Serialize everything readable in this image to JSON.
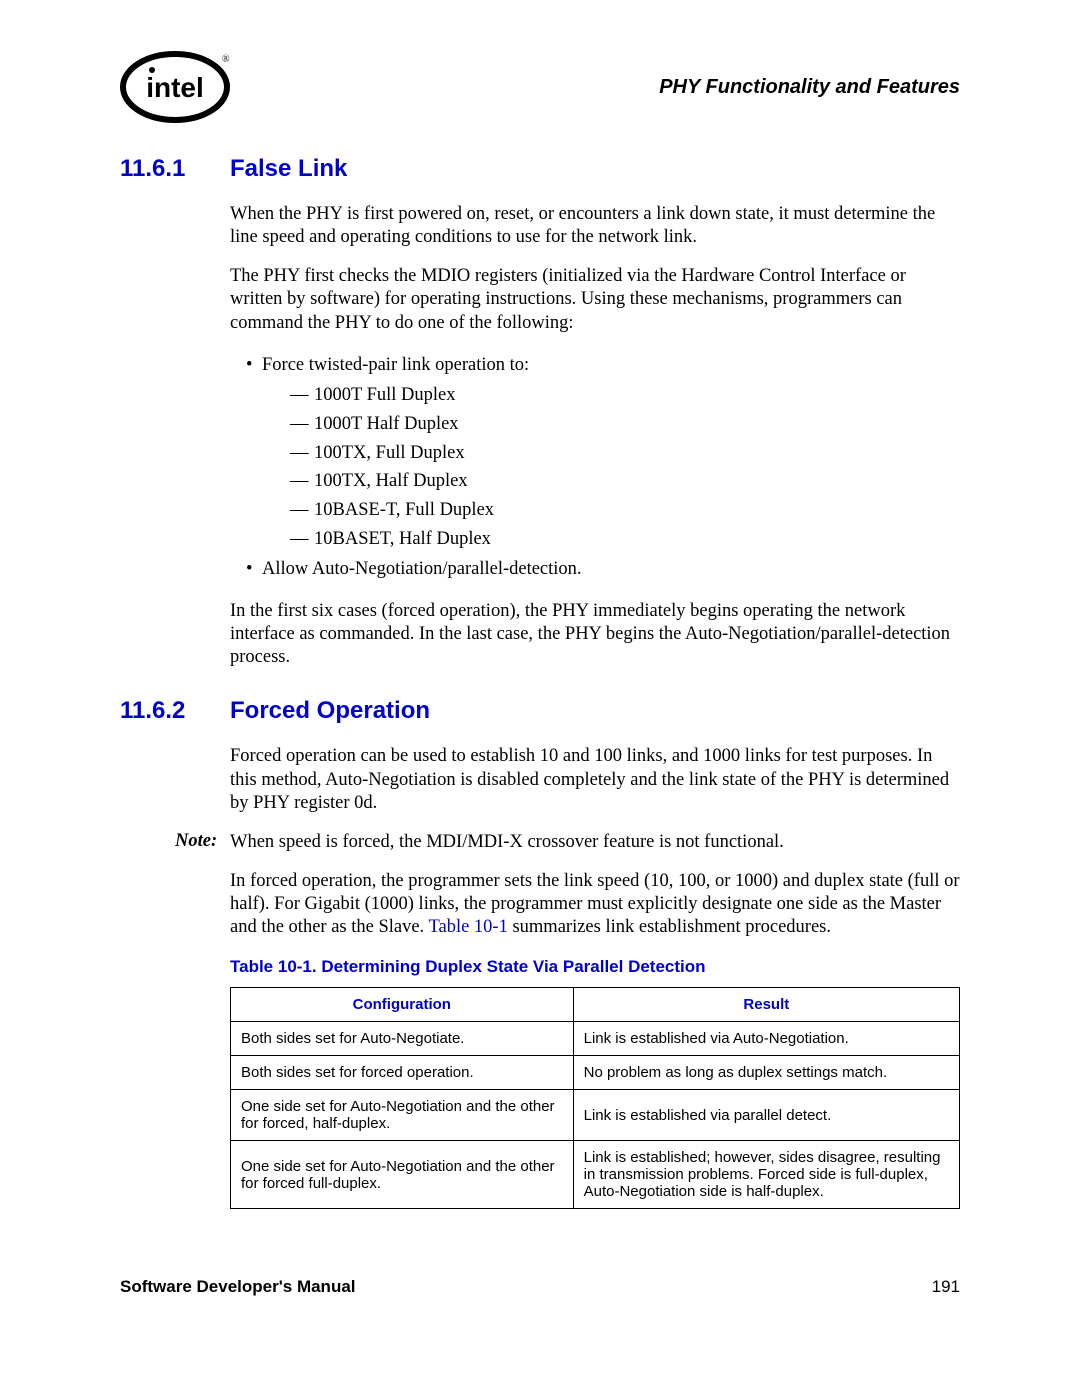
{
  "header": {
    "title": "PHY Functionality and Features"
  },
  "sections": [
    {
      "number": "11.6.1",
      "title": "False Link",
      "paragraphs": [
        "When the PHY is first powered on, reset, or encounters a link down state, it must determine the line speed and operating conditions to use for the network link.",
        "The PHY first checks the MDIO registers (initialized via the Hardware Control Interface or written by software) for operating instructions. Using these mechanisms, programmers can command the PHY to do one of the following:"
      ],
      "bullets": [
        {
          "text": "Force twisted-pair link operation to:",
          "sub": [
            "1000T Full Duplex",
            "1000T Half Duplex",
            "100TX, Full Duplex",
            "100TX, Half Duplex",
            "10BASE-T, Full Duplex",
            "10BASET, Half Duplex"
          ]
        },
        {
          "text": "Allow Auto-Negotiation/parallel-detection."
        }
      ],
      "trailing": "In the first six cases (forced operation), the PHY immediately begins operating the network interface as commanded. In the last case, the PHY begins the Auto-Negotiation/parallel-detection process."
    },
    {
      "number": "11.6.2",
      "title": "Forced Operation",
      "paragraphs": [
        "Forced operation can be used to establish 10 and 100 links, and 1000 links for test purposes. In this method, Auto-Negotiation is disabled completely and the link state of the PHY is determined by PHY register 0d."
      ],
      "note_label": "Note:",
      "note": "When speed is forced, the MDI/MDI-X crossover feature is not functional.",
      "after_note_pre": "In forced operation, the programmer sets the link speed (10, 100, or 1000) and duplex state (full or half). For Gigabit (1000) links, the programmer must explicitly designate one side as the Master and the other as the Slave. ",
      "after_note_link": "Table 10-1",
      "after_note_post": " summarizes link establishment procedures.",
      "table_title": "Table 10-1. Determining Duplex State Via Parallel Detection",
      "table": {
        "headers": [
          "Configuration",
          "Result"
        ],
        "rows": [
          [
            "Both sides set for Auto-Negotiate.",
            "Link is established via Auto-Negotiation."
          ],
          [
            "Both sides set for forced operation.",
            "No problem as long as duplex settings match."
          ],
          [
            "One side set for Auto-Negotiation and the other for forced, half-duplex.",
            "Link is established via parallel detect."
          ],
          [
            "One side set for Auto-Negotiation and the other for forced full-duplex.",
            "Link is established; however, sides disagree, resulting in transmission problems. Forced side is full-duplex, Auto-Negotiation side is half-duplex."
          ]
        ]
      }
    }
  ],
  "footer": {
    "left": "Software Developer's Manual",
    "right": "191"
  }
}
